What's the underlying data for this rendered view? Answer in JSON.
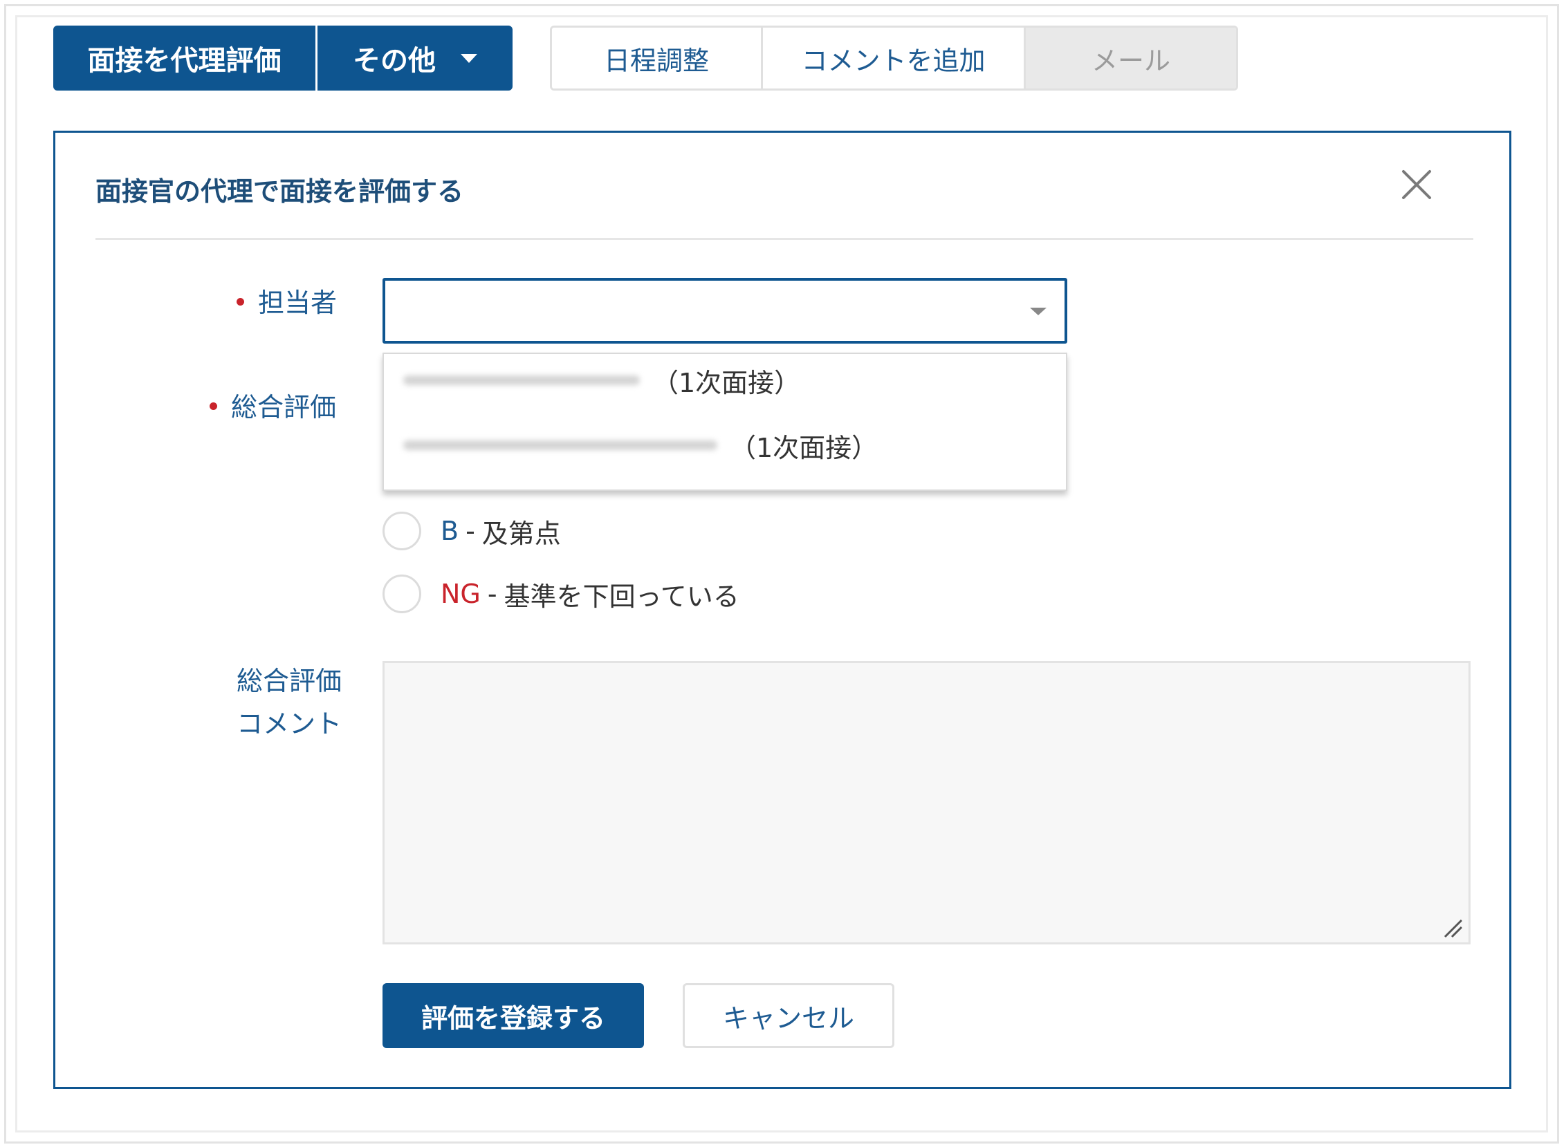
{
  "toolbar": {
    "proxy_evaluate_label": "面接を代理評価",
    "more_label": "その他",
    "schedule_label": "日程調整",
    "add_comment_label": "コメントを追加",
    "mail_label": "メール"
  },
  "panel": {
    "title": "面接官の代理で面接を評価する"
  },
  "form": {
    "assignee_label": "担当者",
    "overall_label": "総合評価",
    "comment_label_line1": "総合評価",
    "comment_label_line2": "コメント",
    "assignee_options": [
      {
        "suffix": "（1次面接）"
      },
      {
        "suffix": "（1次面接）"
      }
    ],
    "grades": [
      {
        "code": "B",
        "separator": "-",
        "desc": "及第点",
        "color": "#1e5b92"
      },
      {
        "code": "NG",
        "separator": "-",
        "desc": "基準を下回っている",
        "color": "#c9232b"
      }
    ],
    "submit_label": "評価を登録する",
    "cancel_label": "キャンセル"
  },
  "colors": {
    "brand": "#0e5590",
    "required": "#c9232b"
  }
}
